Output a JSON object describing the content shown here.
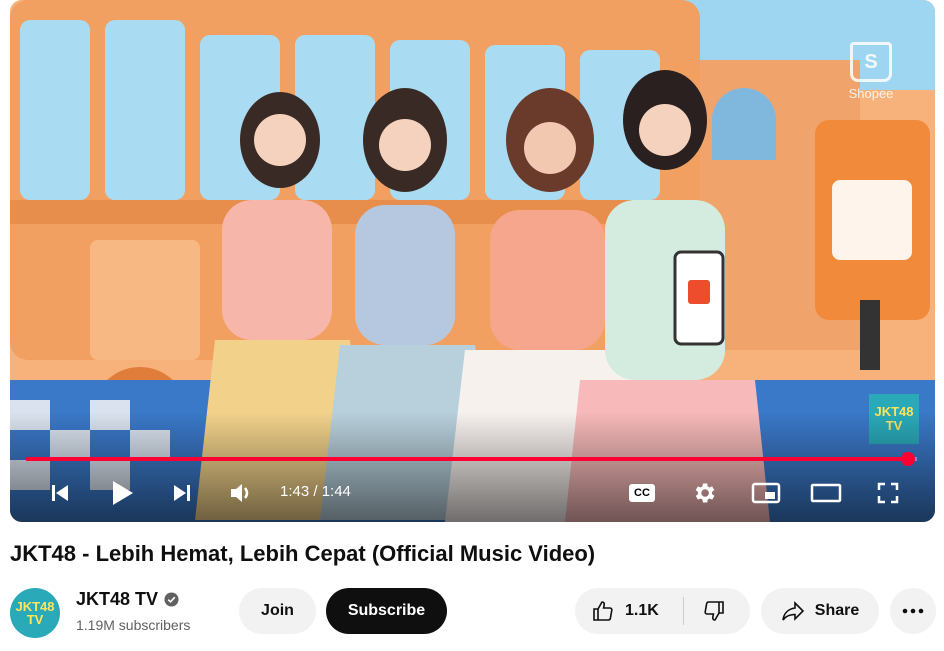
{
  "video": {
    "current_time": "1:43",
    "duration": "1:44",
    "time_display": "1:43 / 1:44",
    "progress": 0.99,
    "watermark_brand": "Shopee",
    "watermark_channel_line1": "JKT48",
    "watermark_channel_line2": "TV",
    "phone_brand": "Shopee"
  },
  "player_controls": {
    "prev_icon": "skip-previous-icon",
    "play_icon": "play-icon",
    "next_icon": "skip-next-icon",
    "volume_icon": "volume-icon",
    "cc_label": "CC",
    "settings_icon": "gear-icon",
    "miniplayer_icon": "miniplayer-icon",
    "theater_icon": "theater-icon",
    "fullscreen_icon": "fullscreen-icon"
  },
  "title": "JKT48 - Lebih Hemat, Lebih Cepat (Official Music Video)",
  "channel": {
    "name": "JKT48 TV",
    "subscribers": "1.19M subscribers",
    "avatar_line1": "JKT48",
    "avatar_line2": "TV",
    "verified_icon": "verified-check-icon"
  },
  "actions": {
    "join_label": "Join",
    "subscribe_label": "Subscribe",
    "like_count": "1.1K",
    "share_label": "Share",
    "more_icon": "more-horizontal-icon"
  },
  "colors": {
    "accent_red": "#ff0033",
    "scene_orange": "#f3a56b",
    "sky_blue": "#8fd0f0"
  }
}
